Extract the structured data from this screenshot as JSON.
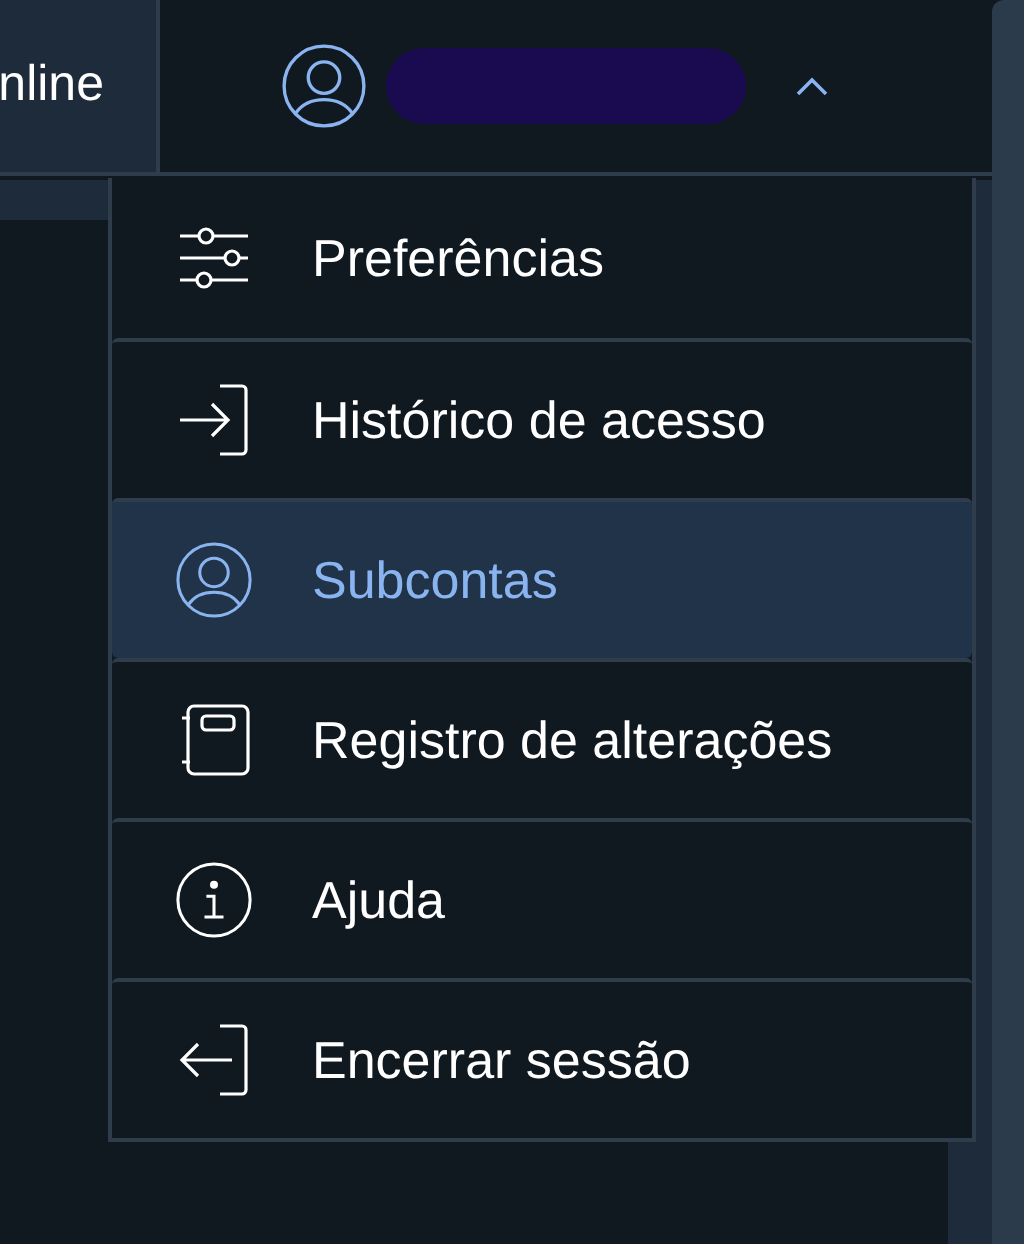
{
  "header": {
    "tab_label": "nline",
    "user_menu": {
      "expanded": true
    }
  },
  "menu": [
    {
      "kind": "sliders",
      "label": "Preferências",
      "selected": false
    },
    {
      "kind": "enter",
      "label": "Histórico de acesso",
      "selected": false
    },
    {
      "kind": "user",
      "label": "Subcontas",
      "selected": true
    },
    {
      "kind": "notebook",
      "label": "Registro de alterações",
      "selected": false
    },
    {
      "kind": "info",
      "label": "Ajuda",
      "selected": false
    },
    {
      "kind": "exit",
      "label": "Encerrar sessão",
      "selected": false
    }
  ]
}
